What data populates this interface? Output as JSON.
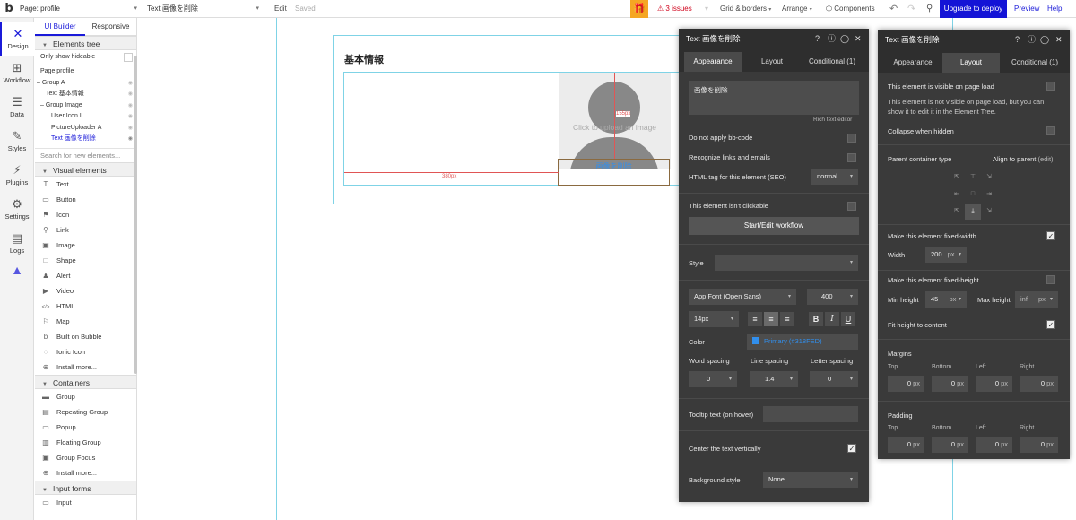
{
  "topbar": {
    "logo": "b",
    "page_selector": "Page: profile",
    "element_selector": "Text 画像を削除",
    "edit": "Edit",
    "saved": "Saved",
    "issues": "3 issues",
    "grid_borders": "Grid & borders",
    "arrange": "Arrange",
    "components": "Components",
    "upgrade": "Upgrade to deploy",
    "preview": "Preview",
    "help": "Help"
  },
  "rail": [
    {
      "label": "Design",
      "icon": "design-icon"
    },
    {
      "label": "Workflow",
      "icon": "workflow-icon"
    },
    {
      "label": "Data",
      "icon": "data-icon"
    },
    {
      "label": "Styles",
      "icon": "styles-icon"
    },
    {
      "label": "Plugins",
      "icon": "plugins-icon"
    },
    {
      "label": "Settings",
      "icon": "settings-icon"
    },
    {
      "label": "Logs",
      "icon": "logs-icon"
    }
  ],
  "left_panel": {
    "tabs": [
      "UI Builder",
      "Responsive"
    ],
    "elements_tree_title": "Elements tree",
    "only_show_hideable": "Only show hideable",
    "tree": [
      {
        "label": "Page profile",
        "indent": 0
      },
      {
        "label": "Group A",
        "indent": 0
      },
      {
        "label": "Text 基本情報",
        "indent": 1
      },
      {
        "label": "Group Image",
        "indent": 0
      },
      {
        "label": "User Icon L",
        "indent": 2
      },
      {
        "label": "PictureUploader A",
        "indent": 2
      },
      {
        "label": "Text 画像を削除",
        "indent": 2
      }
    ],
    "search_placeholder": "Search for new elements...",
    "visual_elements_title": "Visual elements",
    "visual_elements": [
      {
        "label": "Text",
        "icon": "T"
      },
      {
        "label": "Button",
        "icon": "▭"
      },
      {
        "label": "Icon",
        "icon": "⚑"
      },
      {
        "label": "Link",
        "icon": "⚲"
      },
      {
        "label": "Image",
        "icon": "▣"
      },
      {
        "label": "Shape",
        "icon": "□"
      },
      {
        "label": "Alert",
        "icon": "♟"
      },
      {
        "label": "Video",
        "icon": "▶"
      },
      {
        "label": "HTML",
        "icon": "</>"
      },
      {
        "label": "Map",
        "icon": "⚐"
      },
      {
        "label": "Built on Bubble",
        "icon": "b"
      },
      {
        "label": "Ionic Icon",
        "icon": "◌"
      },
      {
        "label": "Install more...",
        "icon": "⊕"
      }
    ],
    "containers_title": "Containers",
    "containers": [
      {
        "label": "Group",
        "icon": "▬"
      },
      {
        "label": "Repeating Group",
        "icon": "▤"
      },
      {
        "label": "Popup",
        "icon": "▭"
      },
      {
        "label": "Floating Group",
        "icon": "▥"
      },
      {
        "label": "Group Focus",
        "icon": "▣"
      },
      {
        "label": "Install more...",
        "icon": "⊕"
      }
    ],
    "input_forms_title": "Input forms",
    "input_forms": [
      {
        "label": "Input",
        "icon": "▭"
      }
    ]
  },
  "canvas": {
    "heading": "基本情報",
    "upload_hint": "Click to upload an image",
    "delete_text": "画像を削除",
    "width_marker": "380px",
    "height_marker": "155px"
  },
  "panel_appearance": {
    "title": "Text 画像を削除",
    "tabs": [
      "Appearance",
      "Layout",
      "Conditional (1)"
    ],
    "content_text": "画像を削除",
    "rich_text_editor": "Rich text editor",
    "do_not_apply_bbcode": "Do not apply bb-code",
    "recognize_links": "Recognize links and emails",
    "html_tag_label": "HTML tag for this element (SEO)",
    "html_tag_value": "normal",
    "not_clickable": "This element isn't clickable",
    "start_workflow": "Start/Edit workflow",
    "style_label": "Style",
    "font": "App Font (Open Sans)",
    "weight": "400",
    "size": "14px",
    "color_label": "Color",
    "color_value": "Primary (#318FED)",
    "color_swatch": "#318FED",
    "word_spacing_label": "Word spacing",
    "word_spacing": "0",
    "line_spacing_label": "Line spacing",
    "line_spacing": "1.4",
    "letter_spacing_label": "Letter spacing",
    "letter_spacing": "0",
    "tooltip_label": "Tooltip text (on hover)",
    "center_vertically": "Center the text vertically",
    "background_style_label": "Background style",
    "background_style": "None"
  },
  "panel_layout": {
    "title": "Text 画像を削除",
    "tabs": [
      "Appearance",
      "Layout",
      "Conditional (1)"
    ],
    "visible_on_load": "This element is visible on page load",
    "not_visible_note": "This element is not visible on page load, but you can show it to edit it in the Element Tree.",
    "collapse_hidden": "Collapse when hidden",
    "parent_container_type": "Parent container type",
    "align_to_parent": "Align to parent",
    "align_edit": "(edit)",
    "fixed_width": "Make this element fixed-width",
    "width_label": "Width",
    "width_value": "200",
    "unit_px": "px",
    "fixed_height": "Make this element fixed-height",
    "min_height_label": "Min height",
    "min_height_value": "45",
    "max_height_label": "Max height",
    "max_height_value": "inf",
    "fit_height": "Fit height to content",
    "margins_title": "Margins",
    "padding_title": "Padding",
    "sides": [
      "Top",
      "Bottom",
      "Left",
      "Right"
    ],
    "margin_values": [
      "0",
      "0",
      "0",
      "0"
    ],
    "padding_values": [
      "0",
      "0",
      "0",
      "0"
    ]
  }
}
